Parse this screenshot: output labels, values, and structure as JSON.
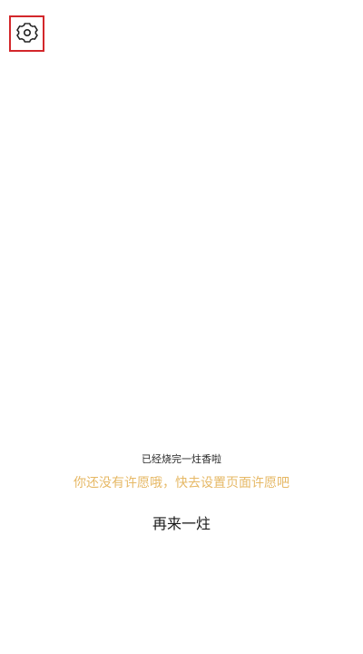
{
  "header": {
    "settings_icon": "gear-icon"
  },
  "main": {
    "status_text": "已经烧完一炷香啦",
    "hint_text": "你还没有许愿哦，快去设置页面许愿吧",
    "again_label": "再来一炷"
  },
  "colors": {
    "hint": "#e6b865",
    "highlight_border": "#d3272b"
  }
}
